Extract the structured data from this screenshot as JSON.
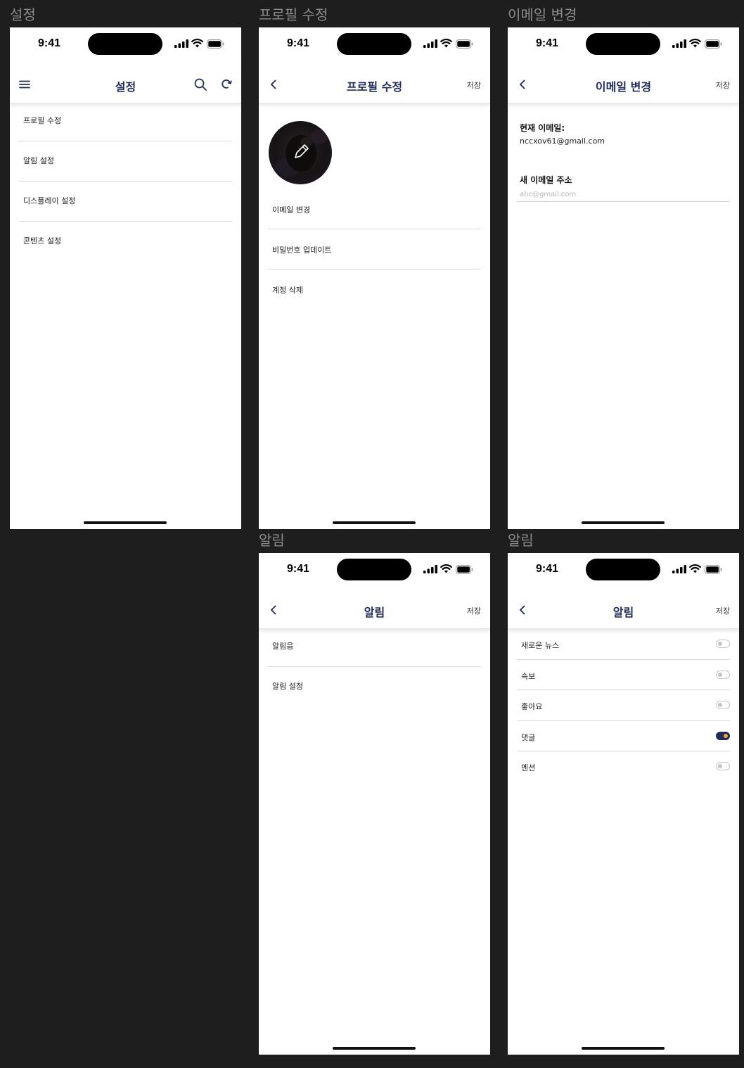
{
  "status": {
    "time": "9:41"
  },
  "labels": {
    "settings": "설정",
    "profile": "프로필 수정",
    "email": "이메일 변경",
    "notify1": "알림",
    "notify2": "알림"
  },
  "settings": {
    "title": "설정",
    "items": [
      {
        "label": "프로필 수정"
      },
      {
        "label": "알림 설정"
      },
      {
        "label": "디스플레이 설정"
      },
      {
        "label": "콘텐츠 설정"
      }
    ]
  },
  "profile": {
    "title": "프로필 수정",
    "save": "저장",
    "items": [
      {
        "label": "이메일 변경"
      },
      {
        "label": "비밀번호 업데이트"
      },
      {
        "label": "계정 삭제"
      }
    ]
  },
  "email": {
    "title": "이메일 변경",
    "save": "저장",
    "current_label": "현재 이메일:",
    "current_value": "nccxov61@gmail.com",
    "new_label": "새 이메일 주소",
    "new_placeholder": "abc@gmail.com"
  },
  "notify1": {
    "title": "알림",
    "save": "저장",
    "items": [
      {
        "label": "알림음"
      },
      {
        "label": "알림 설정"
      }
    ]
  },
  "notify2": {
    "title": "알림",
    "save": "저장",
    "items": [
      {
        "label": "새로운 뉴스",
        "on": false
      },
      {
        "label": "속보",
        "on": false
      },
      {
        "label": "좋아요",
        "on": false
      },
      {
        "label": "댓글",
        "on": true
      },
      {
        "label": "멘션",
        "on": false
      }
    ]
  },
  "colors": {
    "accent": "#1f2b5e",
    "toggle_knob_on": "#f5a623",
    "canvas": "#1e1e1e"
  }
}
